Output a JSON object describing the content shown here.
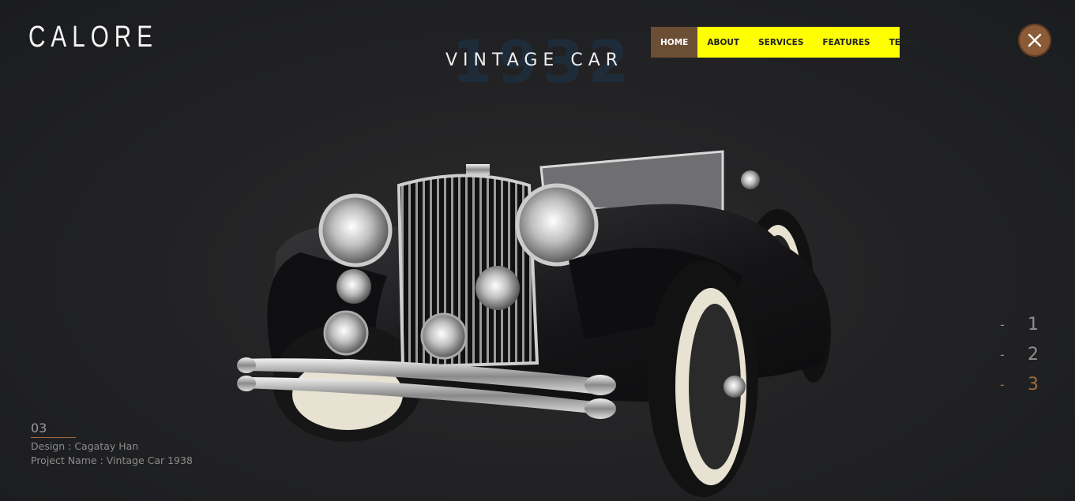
{
  "brand": {
    "logo": "CALORE"
  },
  "hero": {
    "background_year": "1932",
    "title": "VINTAGE CAR"
  },
  "nav": {
    "items": [
      {
        "label": "HOME",
        "active": true
      },
      {
        "label": "ABOUT",
        "active": false
      },
      {
        "label": "SERVICES",
        "active": false
      },
      {
        "label": "FEATURES",
        "active": false
      },
      {
        "label": "TEAM",
        "active": false
      }
    ]
  },
  "close_button": {
    "icon": "close-icon"
  },
  "slides": {
    "items": [
      {
        "dash": "-",
        "number": "1",
        "active": false
      },
      {
        "dash": "-",
        "number": "2",
        "active": false
      },
      {
        "dash": "-",
        "number": "3",
        "active": true
      }
    ]
  },
  "project": {
    "index": "03",
    "design": "Design : Cagatay Han",
    "name": "Project Name : Vintage Car 1938"
  },
  "colors": {
    "accent_brown": "#8b5a36",
    "nav_yellow": "#ffff00",
    "nav_active": "#6b4e34",
    "background": "#232325"
  }
}
